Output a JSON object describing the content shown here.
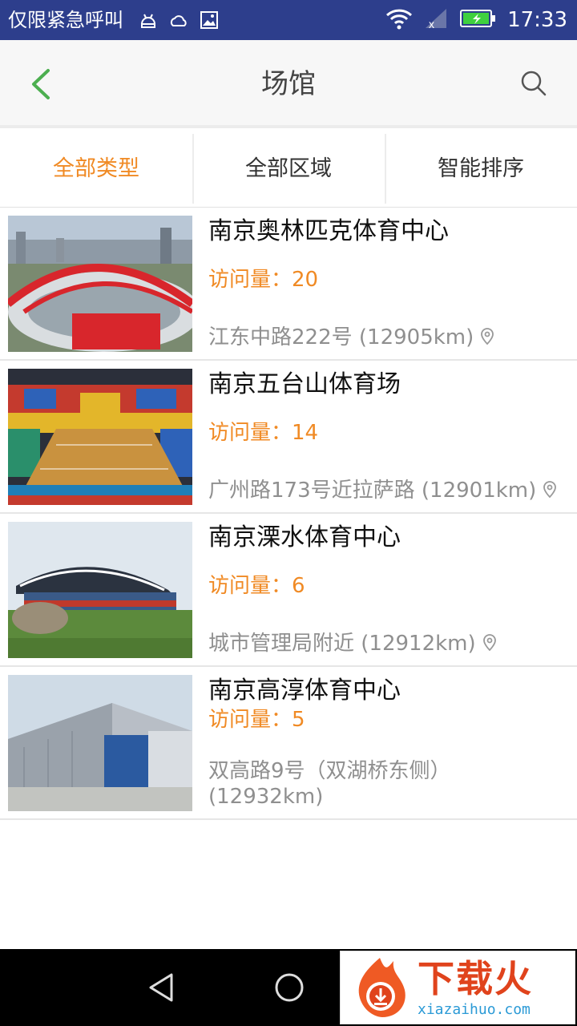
{
  "status_bar": {
    "left_text": "仅限紧急呼叫",
    "time": "17:33",
    "icons": [
      "android-debug-icon",
      "weather-icon",
      "image-icon",
      "wifi-icon",
      "signal-icon",
      "battery-icon"
    ]
  },
  "header": {
    "back_icon": "chevron-left-icon",
    "title": "场馆",
    "search_icon": "search-icon"
  },
  "filters": [
    {
      "label": "全部类型",
      "active": true
    },
    {
      "label": "全部区域",
      "active": false
    },
    {
      "label": "智能排序",
      "active": false
    }
  ],
  "venues": [
    {
      "name": "南京奥林匹克体育中心",
      "visits": "访问量：20",
      "address": "江东中路222号 (12905km)"
    },
    {
      "name": "南京五台山体育场",
      "visits": "访问量：14",
      "address": "广州路173号近拉萨路 (12901km)"
    },
    {
      "name": "南京溧水体育中心",
      "visits": "访问量：6",
      "address": "城市管理局附近 (12912km)"
    },
    {
      "name": "南京高淳体育中心",
      "visits": "访问量：5",
      "address": "双高路9号（双湖桥东侧）(12932km)"
    }
  ],
  "watermark": {
    "text": "下载火",
    "url": "xiazaihuo.com"
  },
  "colors": {
    "status_bar": "#2d3e8c",
    "accent": "#f08a24",
    "back_arrow": "#4caf50"
  }
}
